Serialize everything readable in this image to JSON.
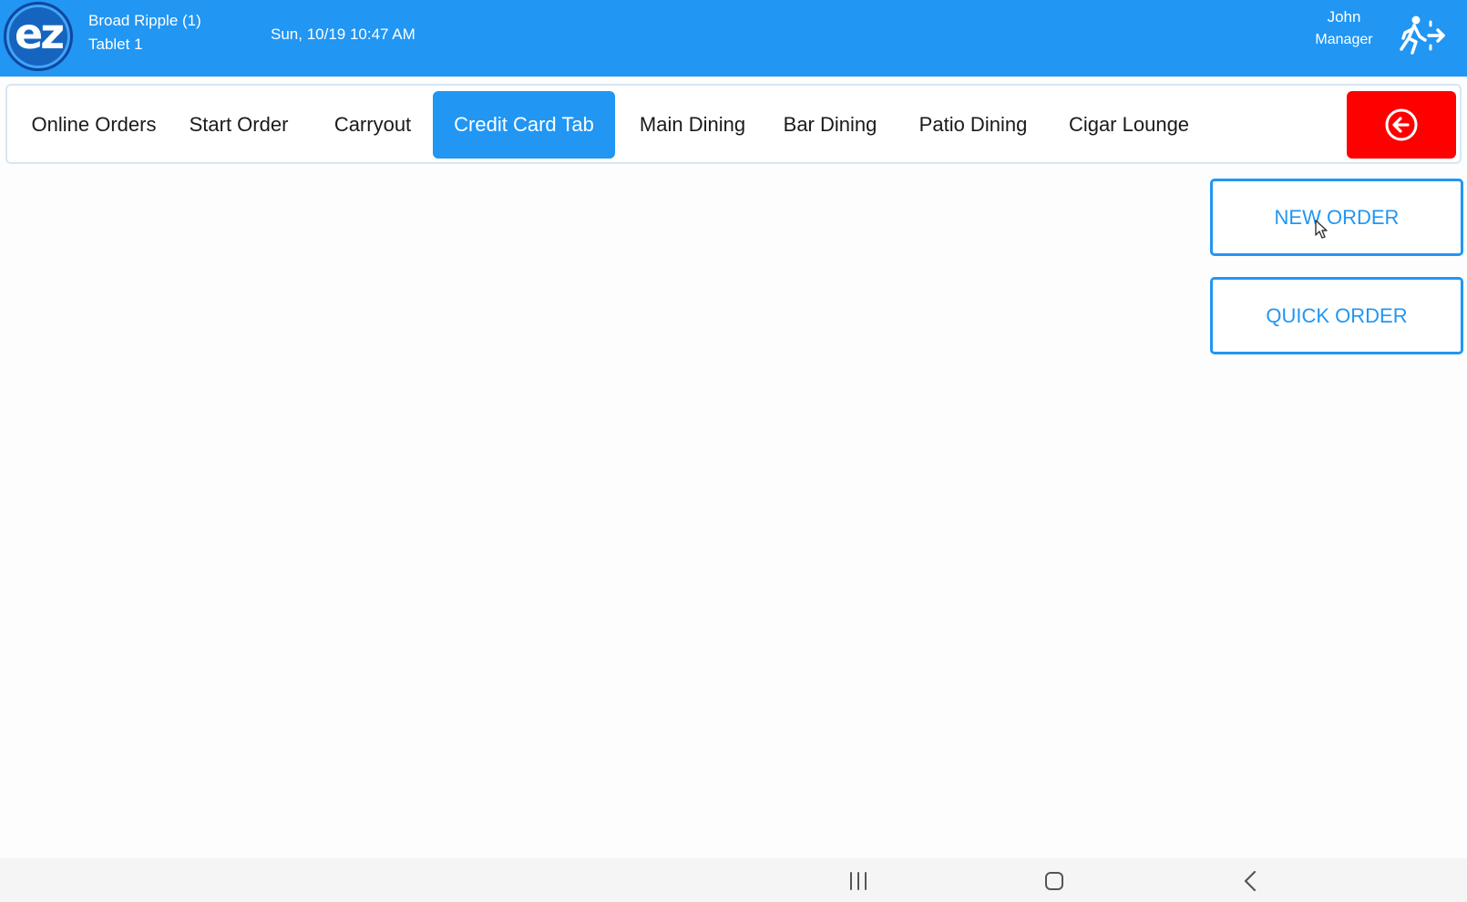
{
  "header": {
    "logo_text": "ez",
    "location": "Broad Ripple (1)",
    "device": "Tablet 1",
    "datetime": "Sun, 10/19 10:47 AM",
    "user_name": "John",
    "user_role": "Manager",
    "logout_icon": "exit-running-person-icon"
  },
  "nav": {
    "tabs": [
      {
        "label": "Online Orders",
        "active": false
      },
      {
        "label": "Start Order",
        "active": false
      },
      {
        "label": "Carryout",
        "active": false
      },
      {
        "label": "Credit Card Tab",
        "active": true
      },
      {
        "label": "Main Dining",
        "active": false
      },
      {
        "label": "Bar Dining",
        "active": false
      },
      {
        "label": "Patio Dining",
        "active": false
      },
      {
        "label": "Cigar Lounge",
        "active": false
      }
    ],
    "back_icon": "arrow-left-circle-icon"
  },
  "actions": {
    "new_order": "NEW ORDER",
    "quick_order": "QUICK ORDER"
  },
  "system_nav": {
    "icons": [
      "recent-apps-icon",
      "home-icon",
      "back-icon"
    ]
  },
  "colors": {
    "primary": "#2196f3",
    "danger": "#ff0000"
  }
}
